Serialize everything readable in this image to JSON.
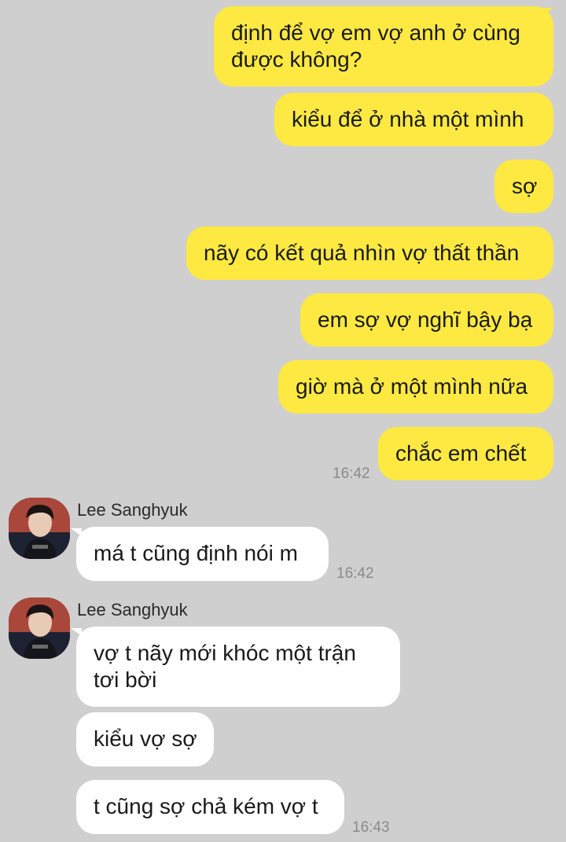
{
  "outgoing": [
    {
      "text": "định để vợ em vợ anh ở cùng\nđược không?"
    },
    {
      "text": "kiểu để ở nhà một mình"
    },
    {
      "text": "sợ"
    },
    {
      "text": "nãy có kết quả nhìn vợ thất thần"
    },
    {
      "text": "em sợ vợ nghĩ bậy bạ"
    },
    {
      "text": "giờ mà ở một mình nữa"
    },
    {
      "text": "chắc em chết"
    }
  ],
  "outgoing_time": "16:42",
  "groups": [
    {
      "sender": "Lee Sanghyuk",
      "messages": [
        {
          "text": "má t cũng định nói m"
        }
      ],
      "time": "16:42"
    },
    {
      "sender": "Lee Sanghyuk",
      "messages": [
        {
          "text": "vợ t nãy mới khóc một trận\ntơi bời"
        },
        {
          "text": "kiểu vợ sợ"
        },
        {
          "text": "t cũng sợ chả kém vợ t"
        }
      ],
      "time": "16:43"
    }
  ],
  "colors": {
    "background": "#cfcfcf",
    "outgoing_bubble": "#fde941",
    "incoming_bubble": "#ffffff",
    "timestamp": "#8a8a8a"
  }
}
